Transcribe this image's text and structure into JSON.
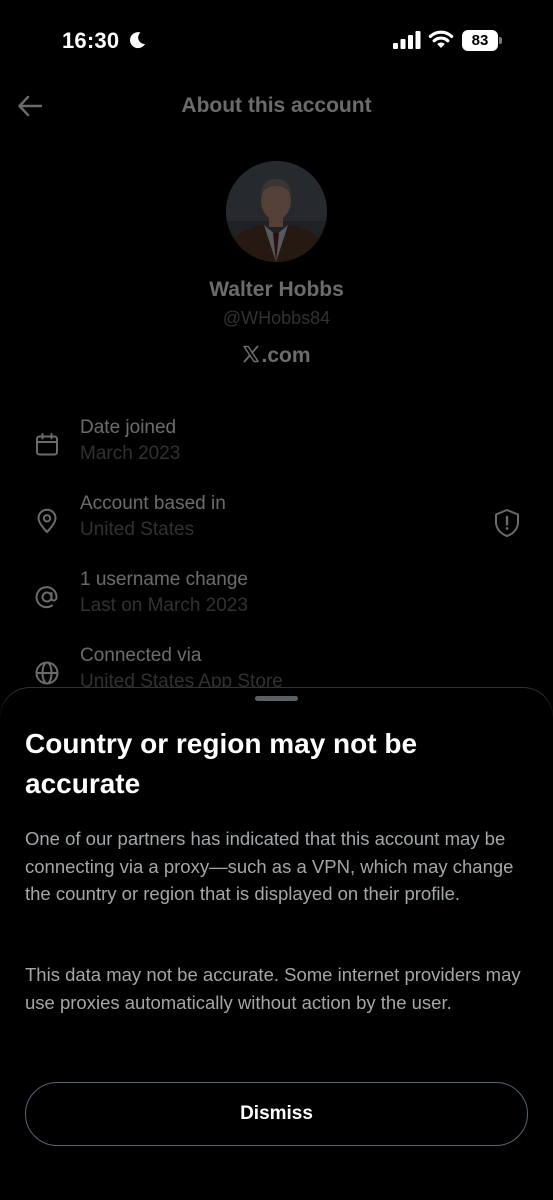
{
  "status_bar": {
    "time": "16:30",
    "battery": "83"
  },
  "header": {
    "title": "About this account"
  },
  "profile": {
    "display_name": "Walter Hobbs",
    "handle": "@WHobbs84",
    "site": ".com"
  },
  "info_items": [
    {
      "label": "Date joined",
      "value": "March 2023",
      "icon": "calendar-icon"
    },
    {
      "label": "Account based in",
      "value": "United States",
      "icon": "location-pin-icon"
    },
    {
      "label": "1 username change",
      "value": "Last on March 2023",
      "icon": "at-sign-icon"
    },
    {
      "label": "Connected via",
      "value": "United States App Store",
      "icon": "globe-icon"
    }
  ],
  "sheet": {
    "title": "Country or region may not be accurate",
    "paragraph_1": "One of our partners has indicated that this account may be connecting via a proxy—such as a VPN, which may change the country or region that is displayed on their profile.",
    "paragraph_2": "This data may not be accurate. Some internet providers may use proxies automatically without action by the user.",
    "dismiss_label": "Dismiss"
  },
  "colors": {
    "background": "#000000",
    "text_primary": "#e7e9ea",
    "text_secondary": "#71767b",
    "button_border": "#536471"
  }
}
